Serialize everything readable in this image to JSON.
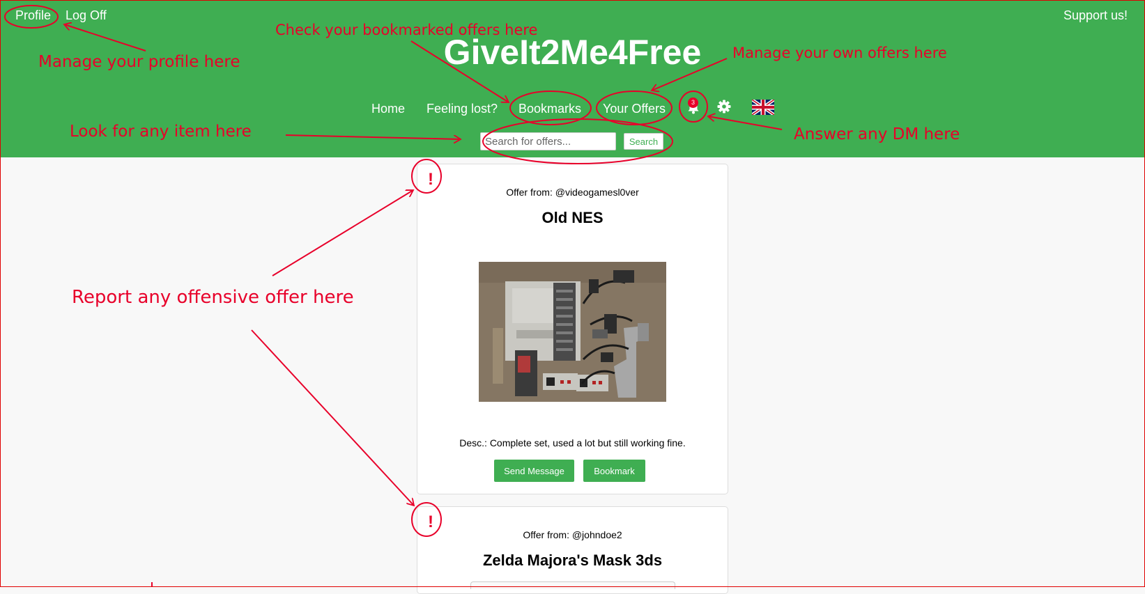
{
  "header": {
    "profile_label": "Profile",
    "logoff_label": "Log Off",
    "support_label": "Support us!",
    "site_title": "GiveIt2Me4Free",
    "nav": {
      "home": "Home",
      "feeling_lost": "Feeling lost?",
      "bookmarks": "Bookmarks",
      "your_offers": "Your Offers"
    },
    "notification_count": "3",
    "search_placeholder": "Search for offers...",
    "search_button": "Search"
  },
  "offers": [
    {
      "report_label": "!",
      "from": "Offer from: @videogamesl0ver",
      "title": "Old NES",
      "image_alt": "NES console with controllers and zapper",
      "description": "Desc.: Complete set, used a lot but still working fine.",
      "send_message": "Send Message",
      "bookmark": "Bookmark"
    },
    {
      "report_label": "!",
      "from": "Offer from: @johndoe2",
      "title": "Zelda Majora's Mask 3ds"
    }
  ],
  "annotations": {
    "profile": "Manage your profile here",
    "bookmarks": "Check your bookmarked offers here",
    "your_offers": "Manage your own offers here",
    "search": "Look for any item here",
    "dm": "Answer any DM here",
    "report": "Report any offensive offer here"
  },
  "colors": {
    "header_bg": "#3fae52",
    "annotation_red": "#e8002a",
    "page_bg": "#f8f8f8"
  },
  "icons": [
    "bell-icon",
    "gear-icon",
    "uk-flag-icon",
    "exclamation-icon"
  ]
}
